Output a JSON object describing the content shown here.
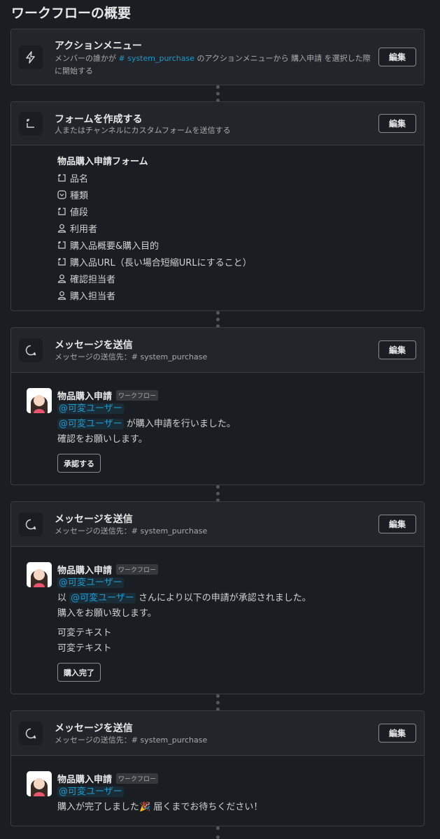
{
  "page_title": "ワークフローの概要",
  "edit_label": "編集",
  "trigger": {
    "title": "アクションメニュー",
    "desc_1": "メンバーの誰かが",
    "channel": "# system_purchase",
    "desc_2": "のアクションメニューから 購入申請 を選択した際",
    "desc_3": "に開始する"
  },
  "form_step": {
    "title": "フォームを作成する",
    "subtitle": "人またはチャンネルにカスタムフォームを送信する",
    "form_name": "物品購入申請フォーム",
    "fields": [
      {
        "label": "品名",
        "icon": "text-field-icon"
      },
      {
        "label": "種類",
        "icon": "dropdown-field-icon"
      },
      {
        "label": "値段",
        "icon": "text-field-icon"
      },
      {
        "label": "利用者",
        "icon": "user-field-icon"
      },
      {
        "label": "購入品概要&購入目的",
        "icon": "text-field-icon"
      },
      {
        "label": "購入品URL（長い場合短縮URLにすること）",
        "icon": "text-field-icon"
      },
      {
        "label": "確認担当者",
        "icon": "user-field-icon"
      },
      {
        "label": "購入担当者",
        "icon": "user-field-icon"
      }
    ]
  },
  "message_steps": [
    {
      "title": "メッセージを送信",
      "subtitle": "メッセージの送信先：# system_purchase",
      "sender": "物品購入申請",
      "badge": "ワークフロー",
      "mention": "@可変ユーザー",
      "line2_mention": "@可変ユーザー",
      "line2_rest": "が購入申請を行いました。",
      "line3": "確認をお願いします。",
      "button": "承認する"
    },
    {
      "title": "メッセージを送信",
      "subtitle": "メッセージの送信先：# system_purchase",
      "sender": "物品購入申請",
      "badge": "ワークフロー",
      "mention": "@可変ユーザー",
      "line2_pre": "以",
      "line2_mention": "@可変ユーザー",
      "line2_rest": "さんにより以下の申請が承認されました。",
      "line3": "購入をお願い致します。",
      "var1": "可変テキスト",
      "var2": "可変テキスト",
      "button": "購入完了"
    },
    {
      "title": "メッセージを送信",
      "subtitle": "メッセージの送信先：# system_purchase",
      "sender": "物品購入申請",
      "badge": "ワークフロー",
      "mention": "@可変ユーザー",
      "line2_a": "購入が完了しました",
      "emoji": "🎉",
      "line2_b": "届くまでお待ちください！"
    }
  ]
}
